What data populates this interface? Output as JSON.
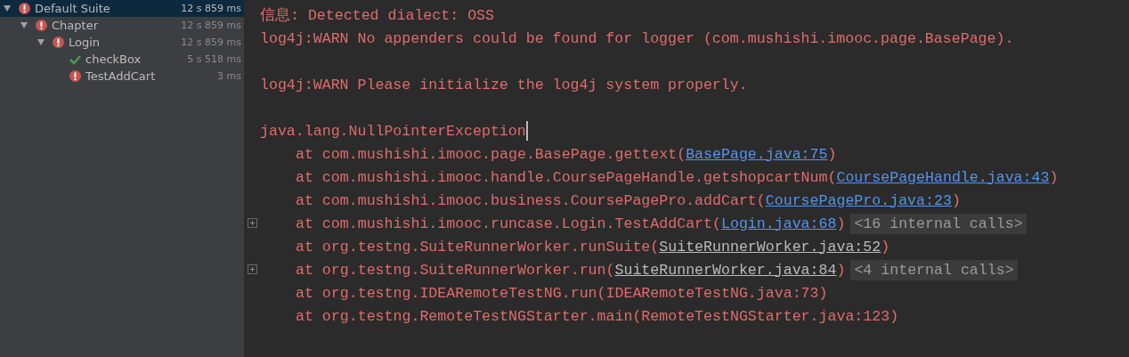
{
  "test_tree": [
    {
      "label": "Default Suite",
      "time": "12 s 859 ms",
      "kind": "failed",
      "selected": true,
      "expanded": true,
      "children": [
        {
          "label": "Chapter",
          "time": "12 s 859 ms",
          "kind": "failed",
          "selected": false,
          "expanded": true,
          "children": [
            {
              "label": "Login",
              "time": "12 s 859 ms",
              "kind": "failed",
              "selected": false,
              "expanded": true,
              "children": [
                {
                  "label": "checkBox",
                  "time": "5 s 518 ms",
                  "kind": "passed",
                  "selected": false
                },
                {
                  "label": "TestAddCart",
                  "time": "3 ms",
                  "kind": "failed",
                  "selected": false
                }
              ]
            }
          ]
        }
      ]
    }
  ],
  "console": [
    {
      "kind": "text",
      "text": "信息: Detected dialect: OSS"
    },
    {
      "kind": "text",
      "text": "log4j:WARN No appenders could be found for logger (com.mushishi.imooc.page.BasePage)."
    },
    {
      "kind": "blank"
    },
    {
      "kind": "text",
      "text": "log4j:WARN Please initialize the log4j system properly."
    },
    {
      "kind": "blank"
    },
    {
      "kind": "text",
      "text": "java.lang.NullPointerException",
      "caret": true
    },
    {
      "kind": "frame",
      "call": "at com.mushishi.imooc.page.BasePage.gettext(",
      "link": {
        "kind": "project",
        "text": "BasePage.java:75"
      },
      "tail": ")"
    },
    {
      "kind": "frame",
      "call": "at com.mushishi.imooc.handle.CoursePageHandle.getshopcartNum(",
      "link": {
        "kind": "project",
        "text": "CoursePageHandle.java:43"
      },
      "tail": ")"
    },
    {
      "kind": "frame",
      "call": "at com.mushishi.imooc.business.CoursePagePro.addCart(",
      "link": {
        "kind": "project",
        "text": "CoursePagePro.java:23"
      },
      "tail": ")"
    },
    {
      "kind": "frame",
      "call": "at com.mushishi.imooc.runcase.Login.TestAddCart(",
      "link": {
        "kind": "project",
        "text": "Login.java:68"
      },
      "tail": ")",
      "foldable": true,
      "folded": "<16 internal calls>"
    },
    {
      "kind": "frame",
      "call": "at org.testng.SuiteRunnerWorker.runSuite(",
      "link": {
        "kind": "library",
        "text": "SuiteRunnerWorker.java:52"
      },
      "tail": ")"
    },
    {
      "kind": "frame",
      "call": "at org.testng.SuiteRunnerWorker.run(",
      "link": {
        "kind": "library",
        "text": "SuiteRunnerWorker.java:84"
      },
      "tail": ")",
      "foldable": true,
      "folded": "<4 internal calls>"
    },
    {
      "kind": "frame",
      "call": "at org.testng.IDEARemoteTestNG.run(IDEARemoteTestNG.java:73)"
    },
    {
      "kind": "frame",
      "call": "at org.testng.RemoteTestNGStarter.main(RemoteTestNGStarter.java:123)"
    }
  ]
}
